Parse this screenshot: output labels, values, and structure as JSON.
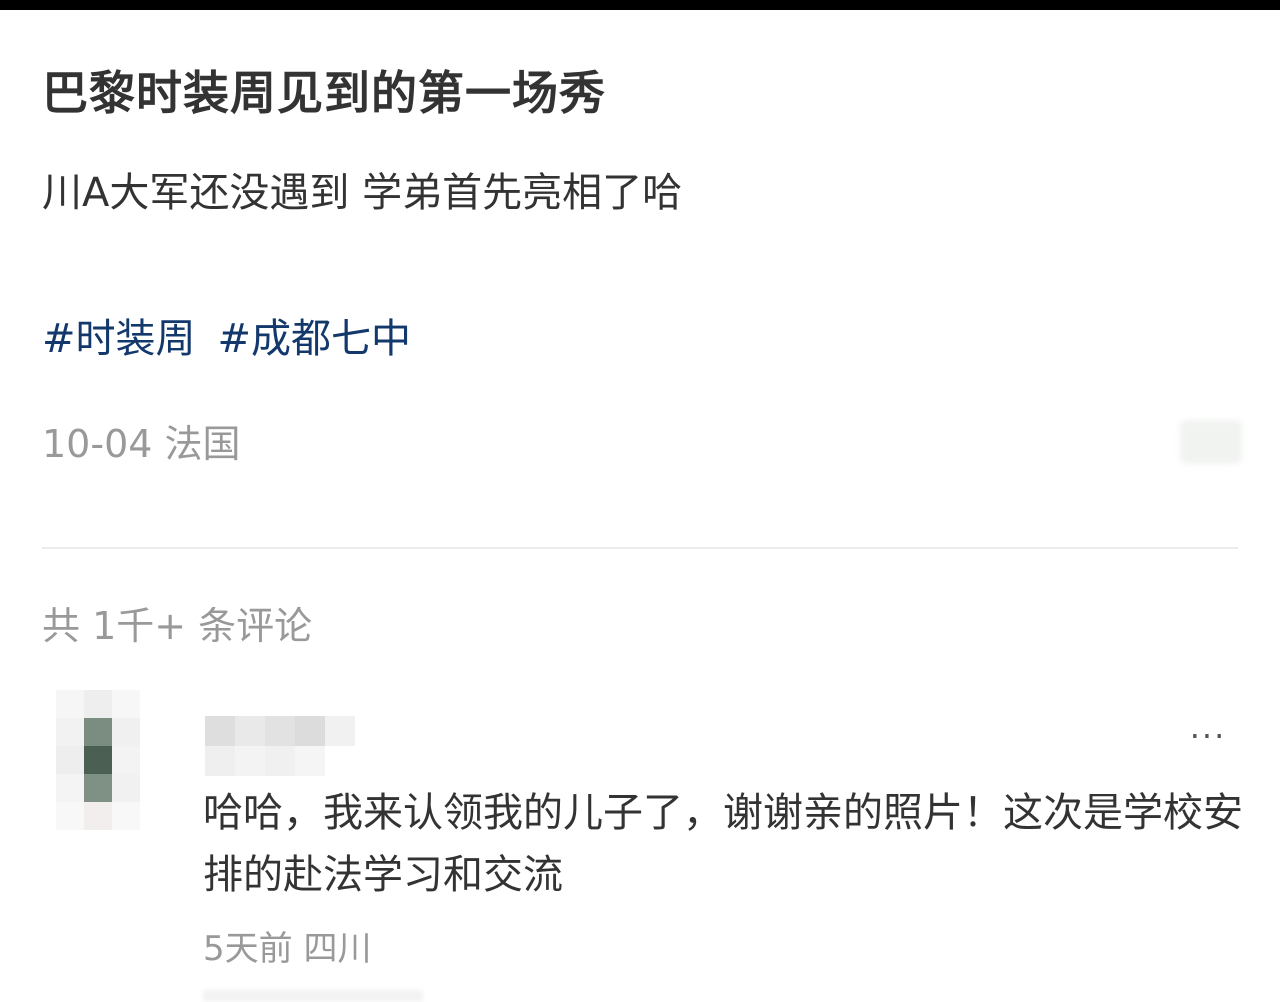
{
  "post": {
    "title": "巴黎时装周见到的第一场秀",
    "body": "川A大军还没遇到 学弟首先亮相了哈",
    "tags": [
      "#时装周",
      "#成都七中"
    ],
    "date": "10-04",
    "location": "法国"
  },
  "comments_header": {
    "count_label": "共 1千+ 条评论"
  },
  "comment": {
    "more_label": "···",
    "text": "哈哈，我来认领我的儿子了，谢谢亲的照片！这次是学校安排的赴法学习和交流",
    "time": "5天前",
    "location": "四川"
  },
  "colors": {
    "tag": "#13386c",
    "muted": "#999999",
    "text": "#333333"
  }
}
